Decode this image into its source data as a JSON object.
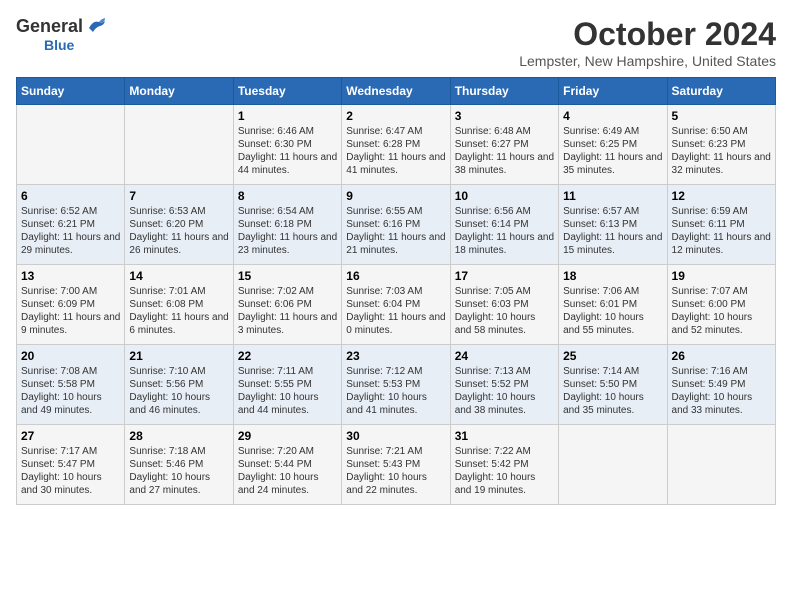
{
  "logo": {
    "general": "General",
    "blue": "Blue"
  },
  "header": {
    "month": "October 2024",
    "location": "Lempster, New Hampshire, United States"
  },
  "weekdays": [
    "Sunday",
    "Monday",
    "Tuesday",
    "Wednesday",
    "Thursday",
    "Friday",
    "Saturday"
  ],
  "weeks": [
    [
      {
        "day": null
      },
      {
        "day": null
      },
      {
        "day": "1",
        "sunrise": "6:46 AM",
        "sunset": "6:30 PM",
        "daylight": "11 hours and 44 minutes."
      },
      {
        "day": "2",
        "sunrise": "6:47 AM",
        "sunset": "6:28 PM",
        "daylight": "11 hours and 41 minutes."
      },
      {
        "day": "3",
        "sunrise": "6:48 AM",
        "sunset": "6:27 PM",
        "daylight": "11 hours and 38 minutes."
      },
      {
        "day": "4",
        "sunrise": "6:49 AM",
        "sunset": "6:25 PM",
        "daylight": "11 hours and 35 minutes."
      },
      {
        "day": "5",
        "sunrise": "6:50 AM",
        "sunset": "6:23 PM",
        "daylight": "11 hours and 32 minutes."
      }
    ],
    [
      {
        "day": "6",
        "sunrise": "6:52 AM",
        "sunset": "6:21 PM",
        "daylight": "11 hours and 29 minutes."
      },
      {
        "day": "7",
        "sunrise": "6:53 AM",
        "sunset": "6:20 PM",
        "daylight": "11 hours and 26 minutes."
      },
      {
        "day": "8",
        "sunrise": "6:54 AM",
        "sunset": "6:18 PM",
        "daylight": "11 hours and 23 minutes."
      },
      {
        "day": "9",
        "sunrise": "6:55 AM",
        "sunset": "6:16 PM",
        "daylight": "11 hours and 21 minutes."
      },
      {
        "day": "10",
        "sunrise": "6:56 AM",
        "sunset": "6:14 PM",
        "daylight": "11 hours and 18 minutes."
      },
      {
        "day": "11",
        "sunrise": "6:57 AM",
        "sunset": "6:13 PM",
        "daylight": "11 hours and 15 minutes."
      },
      {
        "day": "12",
        "sunrise": "6:59 AM",
        "sunset": "6:11 PM",
        "daylight": "11 hours and 12 minutes."
      }
    ],
    [
      {
        "day": "13",
        "sunrise": "7:00 AM",
        "sunset": "6:09 PM",
        "daylight": "11 hours and 9 minutes."
      },
      {
        "day": "14",
        "sunrise": "7:01 AM",
        "sunset": "6:08 PM",
        "daylight": "11 hours and 6 minutes."
      },
      {
        "day": "15",
        "sunrise": "7:02 AM",
        "sunset": "6:06 PM",
        "daylight": "11 hours and 3 minutes."
      },
      {
        "day": "16",
        "sunrise": "7:03 AM",
        "sunset": "6:04 PM",
        "daylight": "11 hours and 0 minutes."
      },
      {
        "day": "17",
        "sunrise": "7:05 AM",
        "sunset": "6:03 PM",
        "daylight": "10 hours and 58 minutes."
      },
      {
        "day": "18",
        "sunrise": "7:06 AM",
        "sunset": "6:01 PM",
        "daylight": "10 hours and 55 minutes."
      },
      {
        "day": "19",
        "sunrise": "7:07 AM",
        "sunset": "6:00 PM",
        "daylight": "10 hours and 52 minutes."
      }
    ],
    [
      {
        "day": "20",
        "sunrise": "7:08 AM",
        "sunset": "5:58 PM",
        "daylight": "10 hours and 49 minutes."
      },
      {
        "day": "21",
        "sunrise": "7:10 AM",
        "sunset": "5:56 PM",
        "daylight": "10 hours and 46 minutes."
      },
      {
        "day": "22",
        "sunrise": "7:11 AM",
        "sunset": "5:55 PM",
        "daylight": "10 hours and 44 minutes."
      },
      {
        "day": "23",
        "sunrise": "7:12 AM",
        "sunset": "5:53 PM",
        "daylight": "10 hours and 41 minutes."
      },
      {
        "day": "24",
        "sunrise": "7:13 AM",
        "sunset": "5:52 PM",
        "daylight": "10 hours and 38 minutes."
      },
      {
        "day": "25",
        "sunrise": "7:14 AM",
        "sunset": "5:50 PM",
        "daylight": "10 hours and 35 minutes."
      },
      {
        "day": "26",
        "sunrise": "7:16 AM",
        "sunset": "5:49 PM",
        "daylight": "10 hours and 33 minutes."
      }
    ],
    [
      {
        "day": "27",
        "sunrise": "7:17 AM",
        "sunset": "5:47 PM",
        "daylight": "10 hours and 30 minutes."
      },
      {
        "day": "28",
        "sunrise": "7:18 AM",
        "sunset": "5:46 PM",
        "daylight": "10 hours and 27 minutes."
      },
      {
        "day": "29",
        "sunrise": "7:20 AM",
        "sunset": "5:44 PM",
        "daylight": "10 hours and 24 minutes."
      },
      {
        "day": "30",
        "sunrise": "7:21 AM",
        "sunset": "5:43 PM",
        "daylight": "10 hours and 22 minutes."
      },
      {
        "day": "31",
        "sunrise": "7:22 AM",
        "sunset": "5:42 PM",
        "daylight": "10 hours and 19 minutes."
      },
      {
        "day": null
      },
      {
        "day": null
      }
    ]
  ],
  "labels": {
    "sunrise": "Sunrise:",
    "sunset": "Sunset:",
    "daylight": "Daylight:"
  }
}
